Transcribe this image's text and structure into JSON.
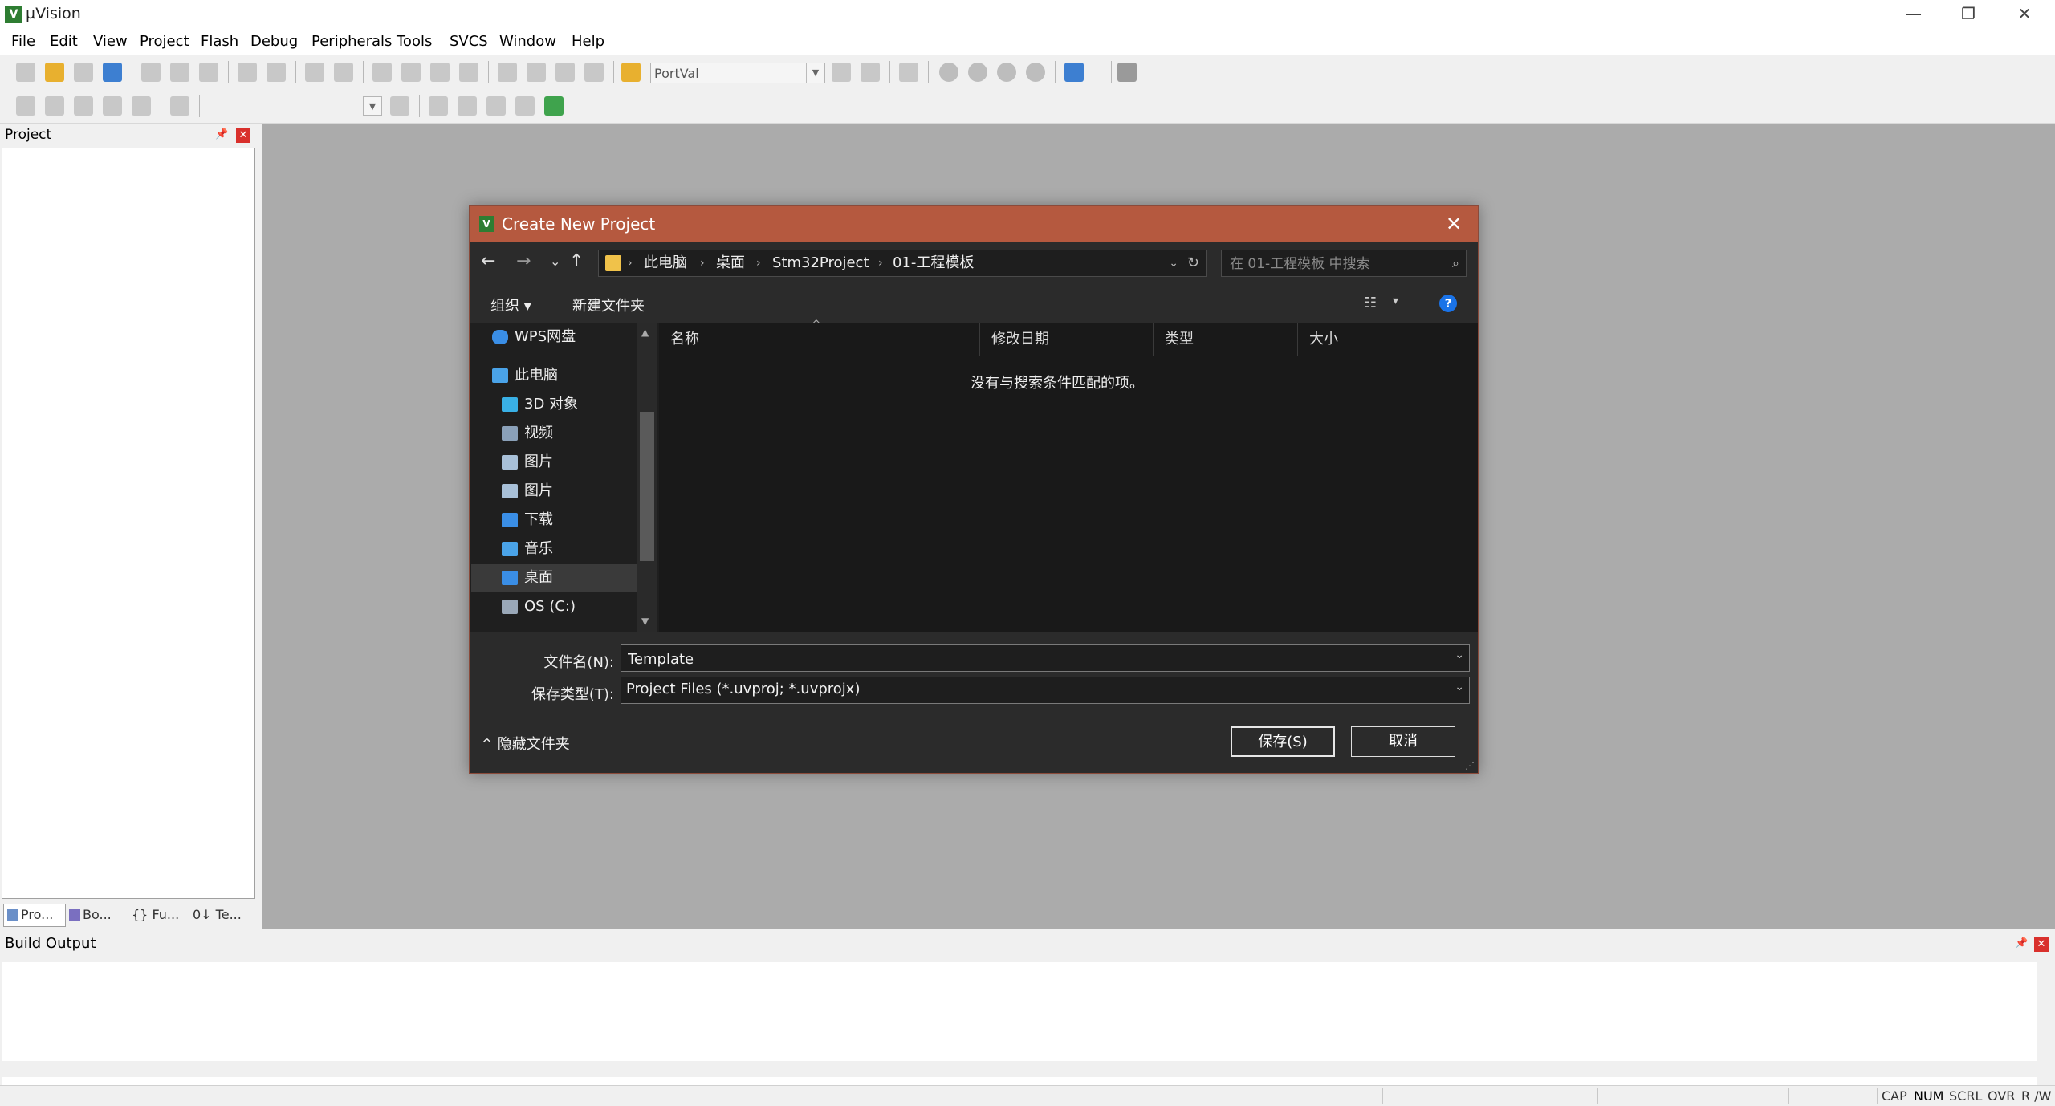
{
  "app": {
    "title": "µVision",
    "icon_glyph": "V"
  },
  "window_controls": {
    "minimize": "—",
    "restore": "❐",
    "close": "✕"
  },
  "menu": [
    "File",
    "Edit",
    "View",
    "Project",
    "Flash",
    "Debug",
    "Peripherals",
    "Tools",
    "SVCS",
    "Window",
    "Help"
  ],
  "toolbar": {
    "target_value": "PortVal"
  },
  "project_panel": {
    "title": "Project",
    "pin": "📌",
    "close": "✕",
    "tabs": [
      "Pro...",
      "Bo...",
      "{} Fu...",
      "0↓ Te..."
    ]
  },
  "build_output": {
    "title": "Build Output",
    "close": "✕"
  },
  "statusbar": [
    "CAP",
    "NUM",
    "SCRL",
    "OVR",
    "R /W"
  ],
  "dialog": {
    "title": "Create New Project",
    "icon_glyph": "V",
    "close": "✕",
    "nav": {
      "back": "←",
      "forward": "→",
      "recent": "⌄",
      "up": "↑"
    },
    "breadcrumb": [
      "此电脑",
      "桌面",
      "Stm32Project",
      "01-工程模板"
    ],
    "breadcrumb_sep": "›",
    "address_dropdown": "⌄",
    "refresh": "↻",
    "search_placeholder": "在 01-工程模板 中搜索",
    "search_icon": "⌕",
    "organize": "组织 ▾",
    "new_folder": "新建文件夹",
    "view_icon": "☷",
    "view_dropdown": "▾",
    "help": "?",
    "nav_items": [
      {
        "label": "WPS网盘",
        "color": "#3a8ee6"
      },
      {
        "label": "此电脑",
        "color": "#4aa3e8"
      },
      {
        "label": "3D 对象",
        "color": "#39b0e5"
      },
      {
        "label": "视频",
        "color": "#8aa0b8"
      },
      {
        "label": "图片",
        "color": "#a8c0d8"
      },
      {
        "label": "图片",
        "color": "#a8c0d8"
      },
      {
        "label": "下载",
        "color": "#3a8ee6"
      },
      {
        "label": "音乐",
        "color": "#4aa3e8"
      },
      {
        "label": "桌面",
        "color": "#3a8ee6"
      },
      {
        "label": "OS (C:)",
        "color": "#9aa8b8"
      }
    ],
    "selected_nav": "桌面",
    "scroll_up": "▲",
    "scroll_down": "▼",
    "columns": [
      "名称",
      "修改日期",
      "类型",
      "大小"
    ],
    "sort_caret": "^",
    "empty_message": "没有与搜索条件匹配的项。",
    "filename_label": "文件名(N):",
    "filename_value": "Template",
    "savetype_label": "保存类型(T):",
    "savetype_value": "Project Files (*.uvproj; *.uvprojx)",
    "field_dropdown": "⌄",
    "hide_folders": "^ 隐藏文件夹",
    "save_button": "保存(S)",
    "cancel_button": "取消",
    "grip": "⋰"
  },
  "colors": {
    "dialog_title_bar": "#b5593f",
    "workspace": "#ababab",
    "dialog_body": "#202020",
    "help_blue": "#1a73e8",
    "panel_close_red": "#d9302c"
  }
}
